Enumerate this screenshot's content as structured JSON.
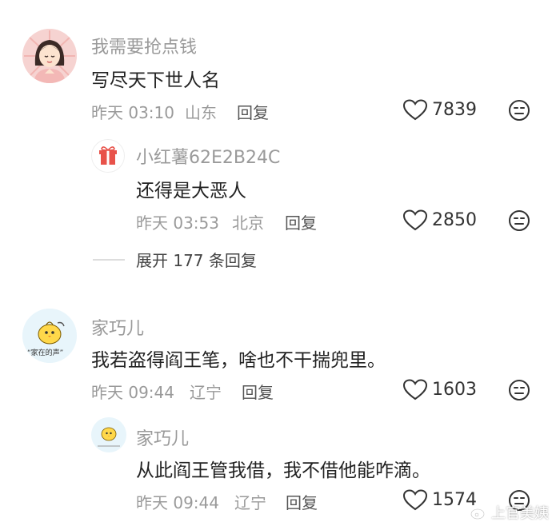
{
  "comments": [
    {
      "username": "我需要抢点钱",
      "text": "写尽天下世人名",
      "time": "昨天 03:10",
      "location": "山东",
      "reply_label": "回复",
      "likes": "7839",
      "replies": [
        {
          "username": "小红薯62E2B24C",
          "text": "还得是大恶人",
          "time": "昨天 03:53",
          "location": "北京",
          "reply_label": "回复",
          "likes": "2850"
        }
      ],
      "expand_label": "展开 177 条回复"
    },
    {
      "username": "家巧儿",
      "avatar_text": "“家在的声”",
      "text": "我若盗得阎王笔，啥也不干揣兜里。",
      "time": "昨天 09:44",
      "location": "辽宁",
      "reply_label": "回复",
      "likes": "1603",
      "replies": [
        {
          "username": "家巧儿",
          "text": "从此阎王管我借，我不借他能咋滴。",
          "time": "昨天 09:44",
          "location": "辽宁",
          "reply_label": "回复",
          "likes": "1574"
        }
      ]
    }
  ],
  "watermark": "上官美姨",
  "icons": {
    "like": "heart-outline-icon",
    "dislike": "meh-face-icon",
    "gift": "gift-icon",
    "watermark": "weibo-logo-icon"
  },
  "colors": {
    "username": "#9a9a9a",
    "text": "#222222",
    "meta": "#9a9a9a"
  }
}
